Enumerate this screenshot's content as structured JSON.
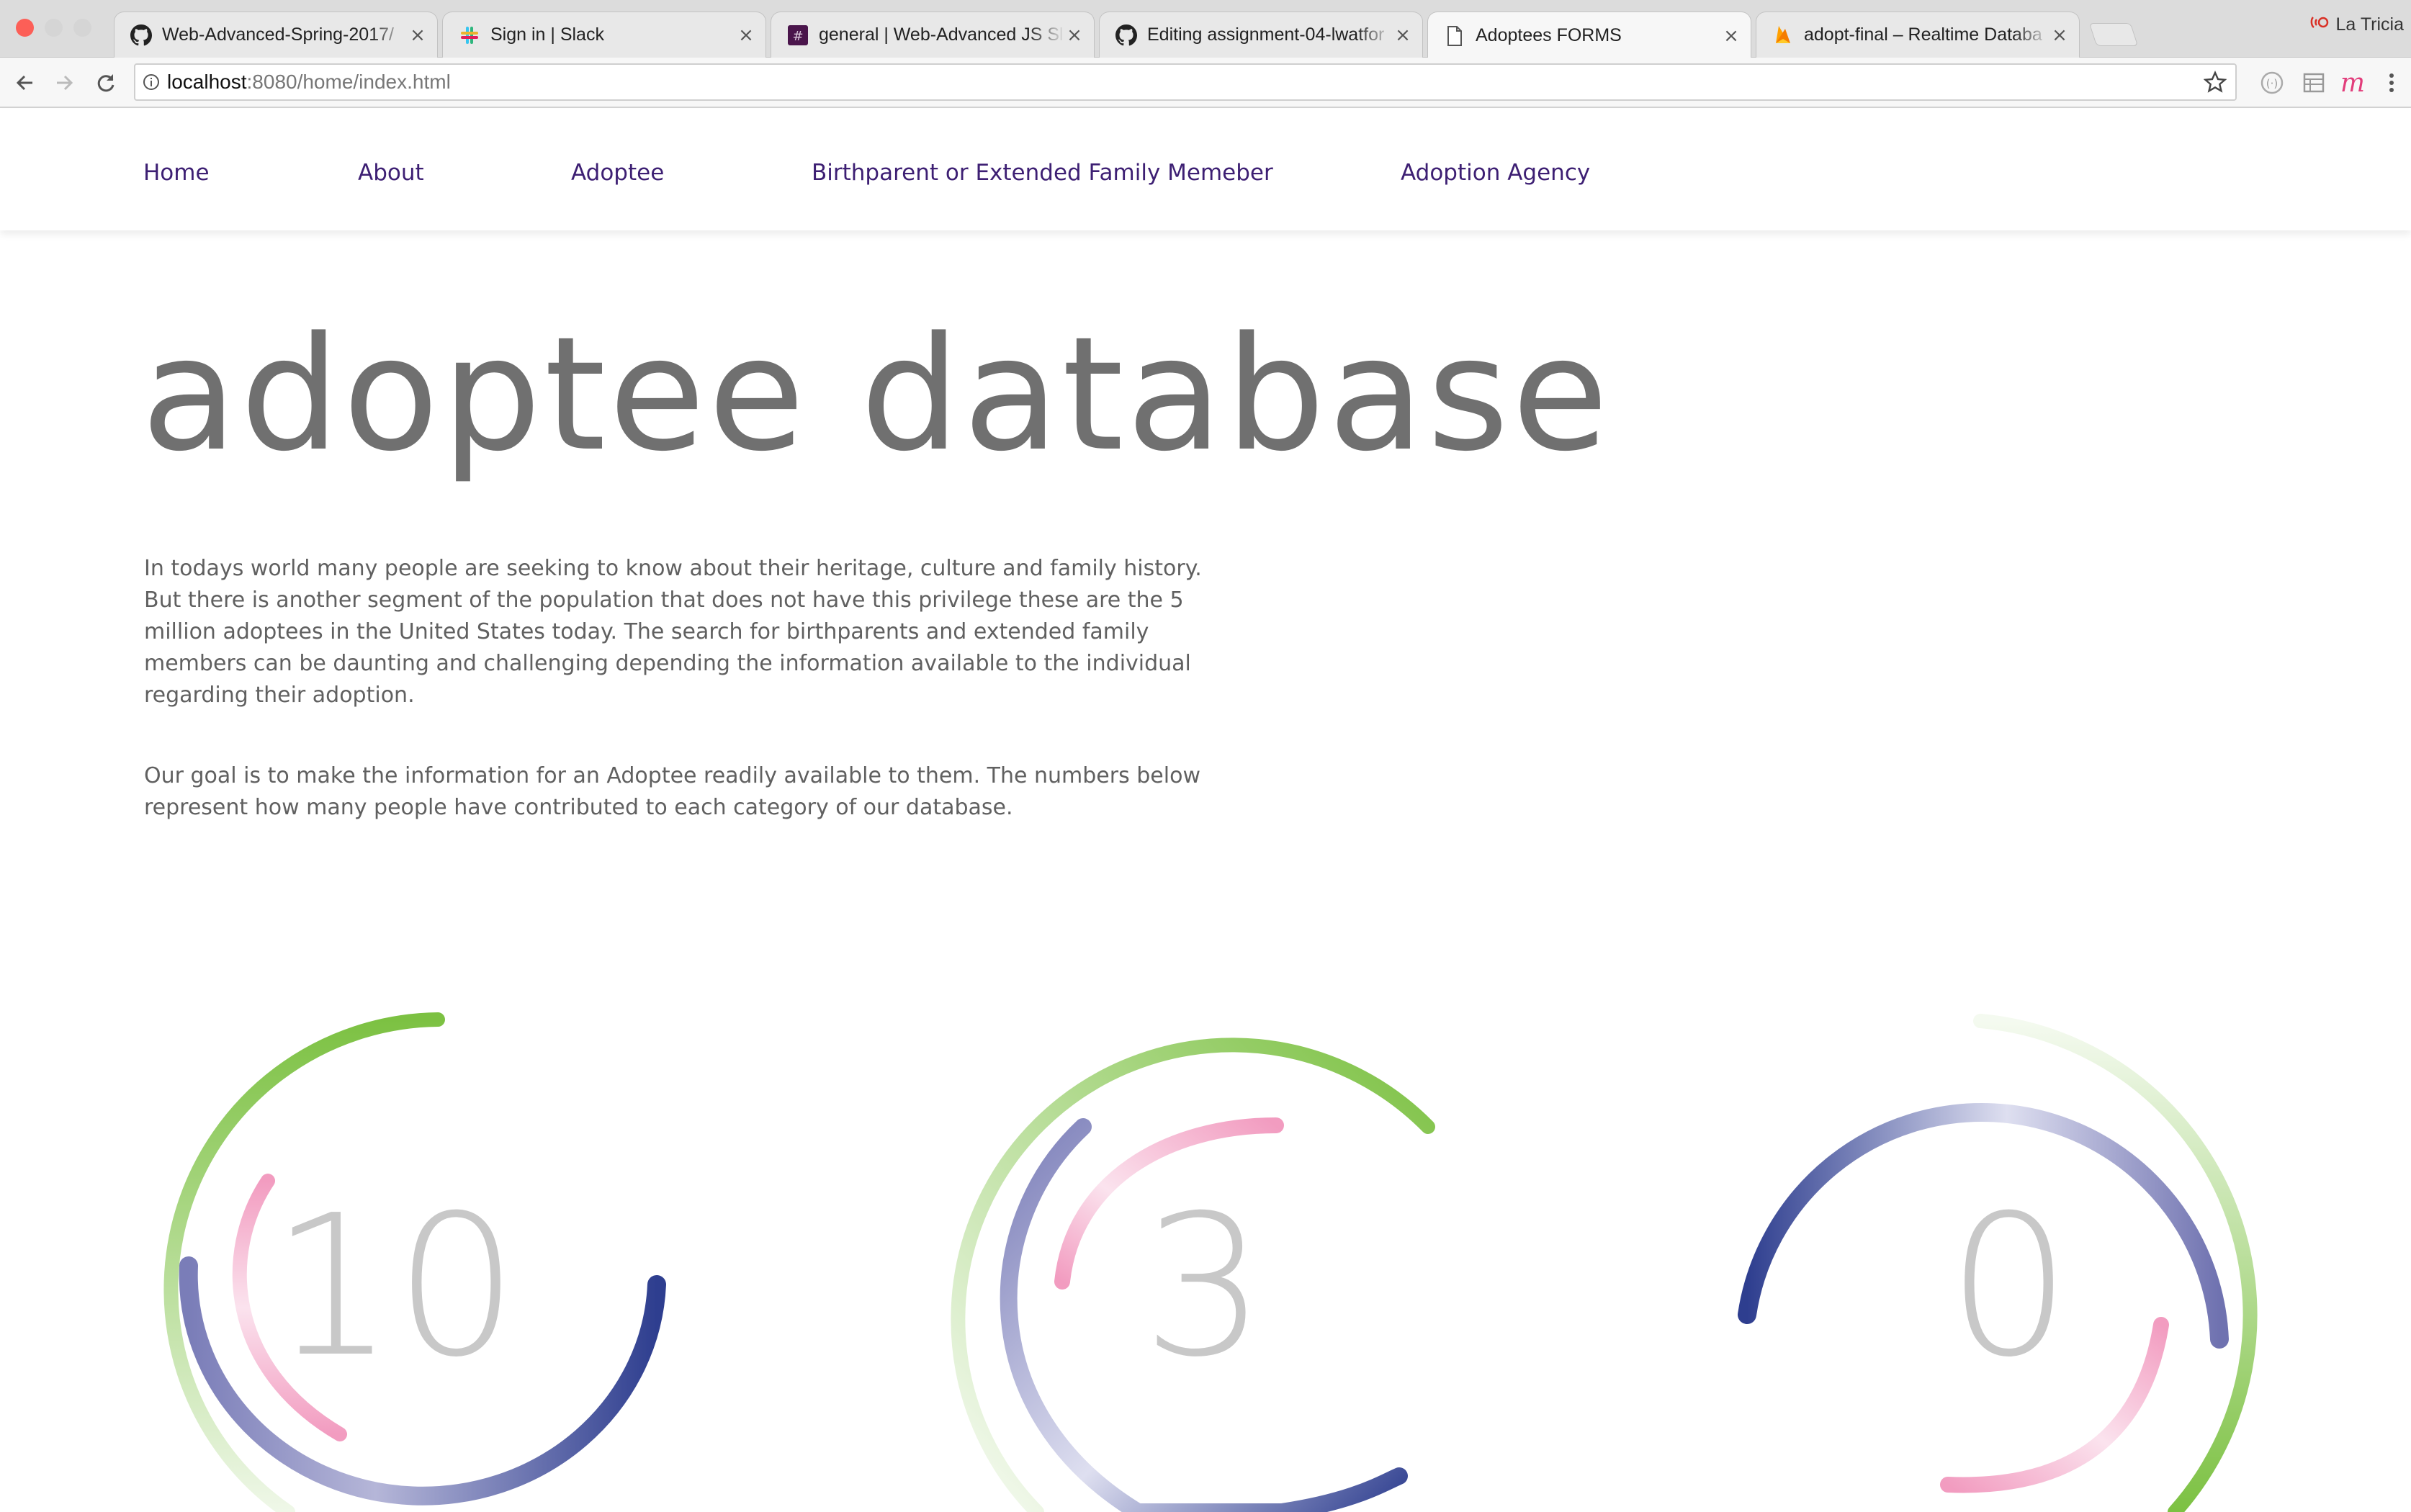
{
  "browser": {
    "tabs": [
      {
        "title": "Web-Advanced-Spring-2017/",
        "icon": "github-icon"
      },
      {
        "title": "Sign in | Slack",
        "icon": "slack-icon"
      },
      {
        "title": "general | Web-Advanced JS Sl",
        "icon": "slack-channel-icon"
      },
      {
        "title": "Editing assignment-04-lwatfor",
        "icon": "github-icon"
      },
      {
        "title": "Adoptees FORMS",
        "icon": "page-icon",
        "active": true
      },
      {
        "title": "adopt-final – Realtime Databa",
        "icon": "firebase-icon"
      }
    ],
    "profile_name": "La Tricia",
    "url_host": "localhost",
    "url_rest": ":8080/home/index.html",
    "accent": "#d93025"
  },
  "nav": {
    "items": [
      {
        "label": "Home"
      },
      {
        "label": "About"
      },
      {
        "label": "Adoptee"
      },
      {
        "label": "Birthparent or Extended Family Memeber"
      },
      {
        "label": "Adoption Agency"
      }
    ],
    "link_color": "#3d1f73"
  },
  "hero": {
    "title": "adoptee database"
  },
  "intro": {
    "paragraph1": "In todays world many people are seeking to know about their heritage, culture and family history. But there is another segment of the population that does not have this privilege these are the 5 million adoptees in the United States today. The search for birthparents and extended family members can be daunting and challenging depending the information available to the individual regarding their adoption.",
    "paragraph2": "Our goal is to make the information for an Adoptee readily available to them. The numbers below represent how many people have contributed to each category of our database."
  },
  "counters": [
    {
      "value": "10"
    },
    {
      "value": "3"
    },
    {
      "value": "0"
    }
  ],
  "colors": {
    "green": "#7cc142",
    "navy": "#2e3e8f",
    "pink": "#f29cc0",
    "count_gray": "#c8c8c8"
  }
}
